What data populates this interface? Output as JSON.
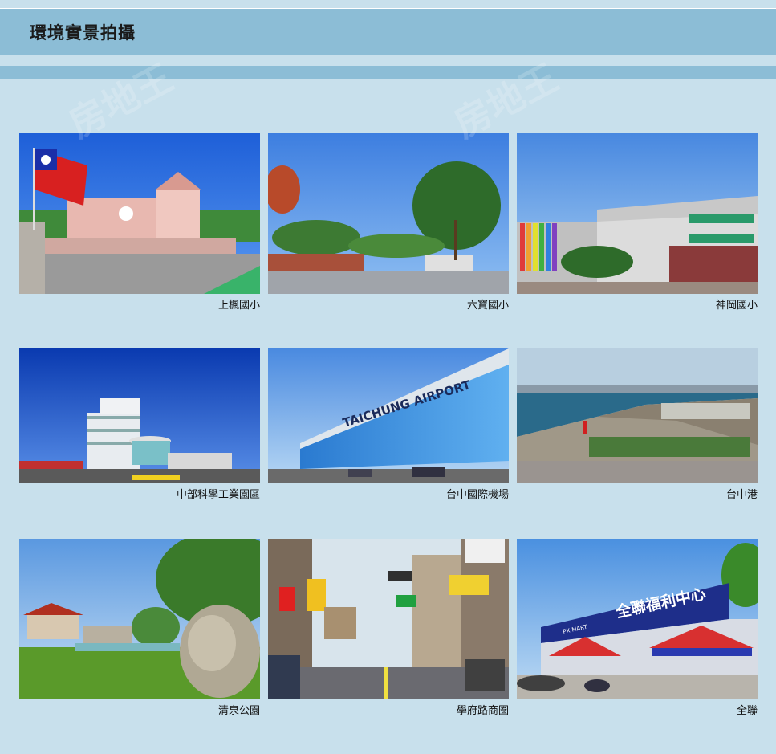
{
  "header": {
    "title": "環境實景拍攝"
  },
  "gallery": {
    "items": [
      {
        "caption": "上楓國小"
      },
      {
        "caption": "六寶國小"
      },
      {
        "caption": "神岡國小"
      },
      {
        "caption": "中部科學工業園區"
      },
      {
        "caption": "台中國際機場"
      },
      {
        "caption": "台中港"
      },
      {
        "caption": "清泉公園"
      },
      {
        "caption": "學府路商圈"
      },
      {
        "caption": "全聯"
      }
    ]
  },
  "photo_text": {
    "airport_sign": "TAICHUNG AIRPORT",
    "store_sign": "全聯福利中心",
    "store_brand": "PX MART"
  },
  "watermark": "房地王"
}
